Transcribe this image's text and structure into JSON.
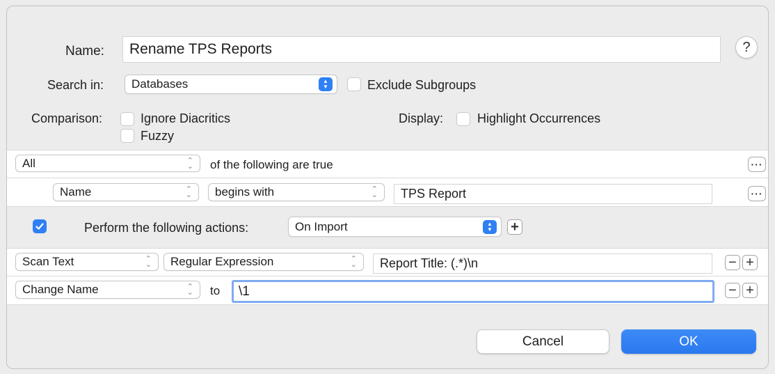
{
  "name": {
    "label": "Name:",
    "value": "Rename TPS Reports"
  },
  "help_icon_glyph": "?",
  "search_in": {
    "label": "Search in:",
    "value": "Databases",
    "exclude_subgroups_label": "Exclude Subgroups"
  },
  "comparison": {
    "label": "Comparison:",
    "ignore_diacritics_label": "Ignore Diacritics",
    "fuzzy_label": "Fuzzy"
  },
  "display": {
    "label": "Display:",
    "highlight_occurrences_label": "Highlight Occurrences"
  },
  "criteria": {
    "match": "All",
    "match_suffix": "of the following are true",
    "row": {
      "field": "Name",
      "operator": "begins with",
      "value": "TPS Report"
    }
  },
  "actions": {
    "enabled": true,
    "label": "Perform the following actions:",
    "trigger": "On Import",
    "rows": [
      {
        "action": "Scan Text",
        "mode": "Regular Expression",
        "value": "Report Title: (.*)\\n"
      },
      {
        "action": "Change Name",
        "connector": "to",
        "value": "\\1"
      }
    ]
  },
  "buttons": {
    "cancel": "Cancel",
    "ok": "OK"
  },
  "colors": {
    "accent": "#2f7ff5"
  }
}
